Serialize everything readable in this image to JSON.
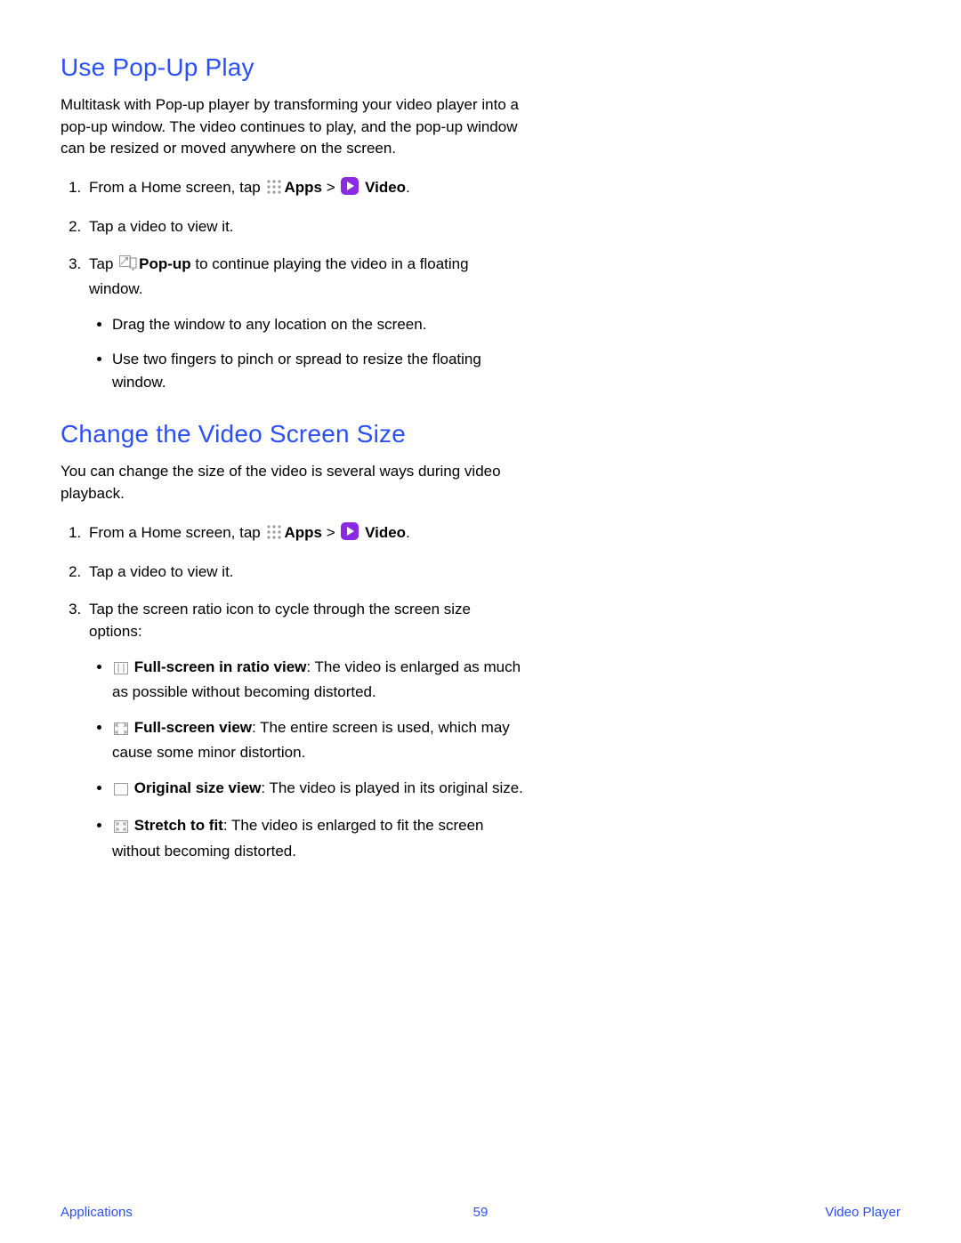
{
  "section1": {
    "heading": "Use Pop-Up Play",
    "intro": "Multitask with Pop-up player by transforming your video player into a pop-up window. The video continues to play, and the pop-up window can be resized or moved anywhere on the screen.",
    "step1_pre": "From a Home screen, tap ",
    "apps_label": "Apps",
    "gt": " > ",
    "video_label": "Video",
    "period": ".",
    "step2": "Tap a video to view it.",
    "step3_pre": "Tap ",
    "popup_label": "Pop-up",
    "step3_post": " to continue playing the video in a floating window.",
    "bullet1": "Drag the window to any location on the screen.",
    "bullet2": "Use two fingers to pinch or spread to resize the floating window."
  },
  "section2": {
    "heading": "Change the Video Screen Size",
    "intro": "You can change the size of the video is several ways during video playback.",
    "step1_pre": "From a Home screen, tap ",
    "apps_label": "Apps",
    "gt": " > ",
    "video_label": "Video",
    "period": ".",
    "step2": "Tap a video to view it.",
    "step3": "Tap the screen ratio icon to cycle through the screen size options:",
    "b1_label": "Full-screen in ratio view",
    "b1_text": ": The video is enlarged as much as possible without becoming distorted.",
    "b2_label": "Full-screen view",
    "b2_text": ": The entire screen is used, which may cause some minor distortion.",
    "b3_label": "Original size view",
    "b3_text": ": The video is played in its original size.",
    "b4_label": "Stretch to fit",
    "b4_text": ": The video is enlarged to fit the screen without becoming distorted."
  },
  "footer": {
    "left": "Applications",
    "page": "59",
    "right": "Video Player"
  },
  "icons": {
    "apps": "apps-grid-icon",
    "video": "video-play-icon",
    "popup": "popup-icon",
    "ratio1": "fullscreen-ratio-icon",
    "ratio2": "fullscreen-view-icon",
    "ratio3": "original-size-icon",
    "ratio4": "stretch-fit-icon"
  }
}
